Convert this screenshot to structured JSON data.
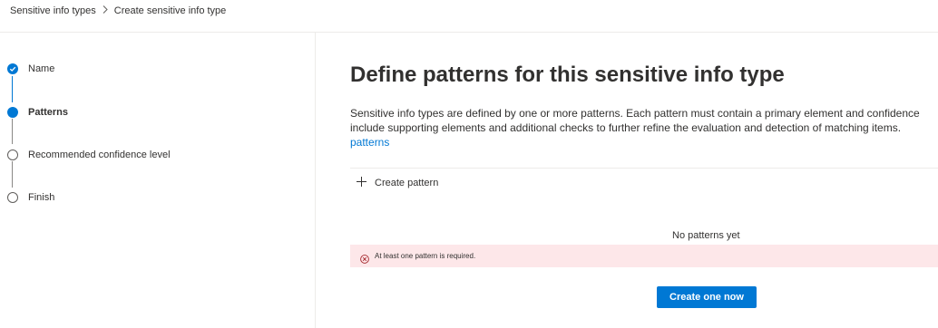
{
  "breadcrumb": {
    "parent": "Sensitive info types",
    "current": "Create sensitive info type",
    "separator_icon": "chevron-right-icon"
  },
  "steps": [
    {
      "label": "Name",
      "state": "completed"
    },
    {
      "label": "Patterns",
      "state": "current"
    },
    {
      "label": "Recommended confidence level",
      "state": "upcoming"
    },
    {
      "label": "Finish",
      "state": "upcoming"
    }
  ],
  "main": {
    "title": "Define patterns for this sensitive info type",
    "description_line1": "Sensitive info types are defined by one or more patterns. Each pattern must contain a primary element and confidence",
    "description_line2": "include supporting elements and additional checks to further refine the evaluation and detection of matching items.",
    "learn_link": "patterns",
    "create_pattern_label": "Create pattern",
    "empty_state": "No patterns yet",
    "error_message": "At least one pattern is required.",
    "create_now_button": "Create one now"
  },
  "colors": {
    "accent": "#0078d4",
    "error_background": "#fde7e9",
    "error_icon": "#a4262c"
  }
}
